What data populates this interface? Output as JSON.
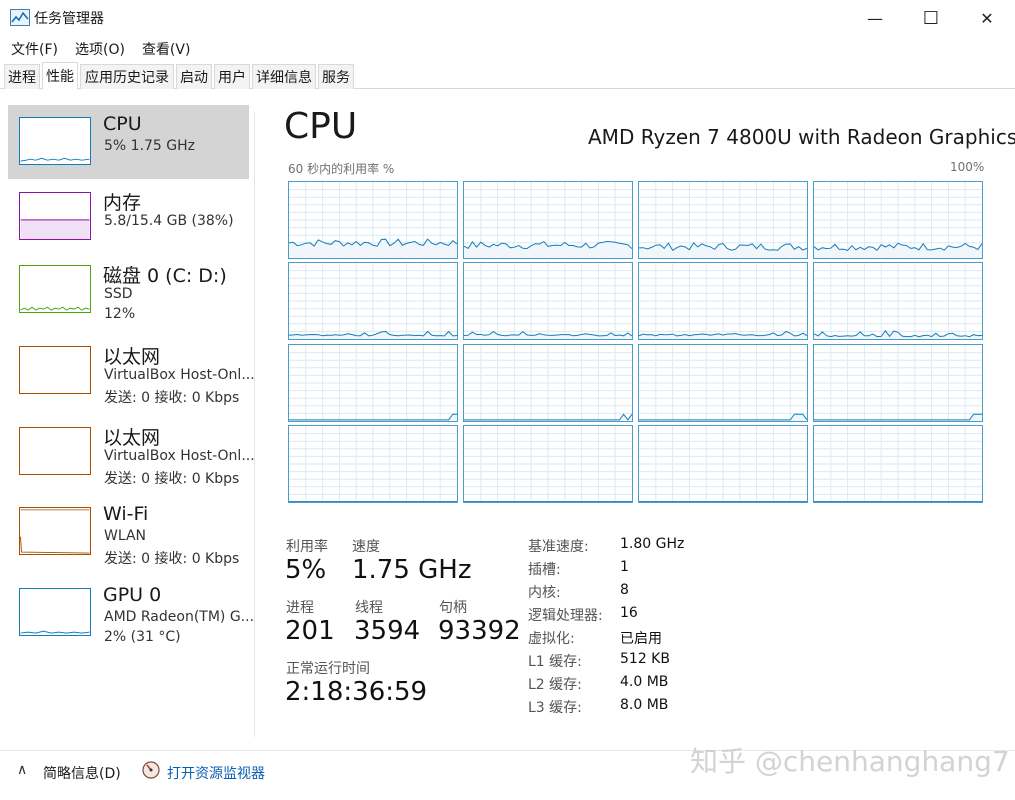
{
  "window": {
    "title": "任务管理器",
    "minimize_glyph": "—",
    "maximize_glyph": "☐",
    "close_glyph": "✕"
  },
  "menu": [
    "文件(F)",
    "选项(O)",
    "查看(V)"
  ],
  "tabs": [
    {
      "label": "进程",
      "active": false
    },
    {
      "label": "性能",
      "active": true
    },
    {
      "label": "应用历史记录",
      "active": false
    },
    {
      "label": "启动",
      "active": false
    },
    {
      "label": "用户",
      "active": false
    },
    {
      "label": "详细信息",
      "active": false
    },
    {
      "label": "服务",
      "active": false
    }
  ],
  "sidebar": {
    "items": [
      {
        "title": "CPU",
        "lines": [
          "5%  1.75 GHz"
        ],
        "color": "#117dbb",
        "icon": "cpu-graph-icon"
      },
      {
        "title": "内存",
        "lines": [
          "5.8/15.4 GB (38%)"
        ],
        "color": "#8b12ae",
        "icon": "memory-graph-icon"
      },
      {
        "title": "磁盘 0 (C: D:)",
        "lines": [
          "SSD",
          "12%"
        ],
        "color": "#4da60c",
        "icon": "disk-graph-icon"
      },
      {
        "title": "以太网",
        "lines": [
          "VirtualBox Host-Onl...",
          "发送: 0  接收: 0 Kbps"
        ],
        "color": "#a74f01",
        "icon": "ethernet-graph-icon"
      },
      {
        "title": "以太网",
        "lines": [
          "VirtualBox Host-Onl...",
          "发送: 0  接收: 0 Kbps"
        ],
        "color": "#a74f01",
        "icon": "ethernet-graph-icon"
      },
      {
        "title": "Wi-Fi",
        "lines": [
          "WLAN",
          "发送: 0  接收: 0 Kbps"
        ],
        "color": "#a74f01",
        "icon": "wifi-graph-icon"
      },
      {
        "title": "GPU 0",
        "lines": [
          "AMD Radeon(TM) G...",
          "2% (31 °C)"
        ],
        "color": "#117dbb",
        "icon": "gpu-graph-icon"
      }
    ]
  },
  "main": {
    "title": "CPU",
    "model": "AMD Ryzen 7 4800U with Radeon Graphics",
    "util_label": "60 秒内的利用率 %",
    "util_max": "100%",
    "graph_color": "#117dbb",
    "cores": 16,
    "stats": {
      "utilization_label": "利用率",
      "utilization": "5%",
      "speed_label": "速度",
      "speed": "1.75 GHz",
      "processes_label": "进程",
      "processes": "201",
      "threads_label": "线程",
      "threads": "3594",
      "handles_label": "句柄",
      "handles": "93392",
      "uptime_label": "正常运行时间",
      "uptime": "2:18:36:59"
    },
    "specs": [
      {
        "k": "基准速度:",
        "v": "1.80 GHz"
      },
      {
        "k": "插槽:",
        "v": "1"
      },
      {
        "k": "内核:",
        "v": "8"
      },
      {
        "k": "逻辑处理器:",
        "v": "16"
      },
      {
        "k": "虚拟化:",
        "v": "已启用"
      },
      {
        "k": "L1 缓存:",
        "v": "512 KB"
      },
      {
        "k": "L2 缓存:",
        "v": "4.0 MB"
      },
      {
        "k": "L3 缓存:",
        "v": "8.0 MB"
      }
    ]
  },
  "footer": {
    "fewer_details": "简略信息(D)",
    "resource_monitor": "打开资源监视器"
  },
  "watermark": "知乎 @chenhanghang7"
}
